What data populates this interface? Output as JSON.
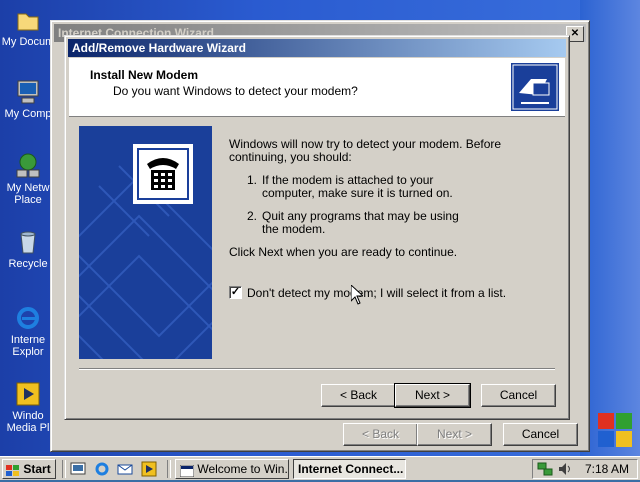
{
  "desktop": {
    "icons": [
      {
        "label": "My Docum",
        "icon": "my-documents-icon"
      },
      {
        "label": "My Comp",
        "icon": "my-computer-icon"
      },
      {
        "label": "My Netw",
        "label2": "Place",
        "icon": "network-places-icon"
      },
      {
        "label": "Recycle",
        "icon": "recycle-bin-icon"
      },
      {
        "label": "Interne",
        "label2": "Explor",
        "icon": "internet-explorer-icon"
      },
      {
        "label": "Windo",
        "label2": "Media Pl",
        "icon": "media-player-icon"
      }
    ]
  },
  "back_window": {
    "title": "Internet Connection Wizard",
    "buttons": {
      "back": "< Back",
      "next": "Next >",
      "cancel": "Cancel"
    }
  },
  "wizard": {
    "title": "Add/Remove Hardware Wizard",
    "header_title": "Install New Modem",
    "header_subtitle": "Do you want Windows to detect your modem?",
    "intro": [
      "Windows will now try to detect your modem.  Before",
      "continuing, you should:"
    ],
    "steps": [
      {
        "num": "1.",
        "lines": [
          "If the modem is attached to your",
          "computer, make sure it is turned on."
        ]
      },
      {
        "num": "2.",
        "lines": [
          "Quit any programs that may be using",
          "the modem."
        ]
      }
    ],
    "click_next": "Click Next when you are ready to continue.",
    "checkbox_label": "Don't detect my modem; I will select it from a list.",
    "checkbox_checked": true,
    "checkmark": "✓",
    "buttons": {
      "back": "< Back",
      "next": "Next >",
      "cancel": "Cancel"
    }
  },
  "taskbar": {
    "start": "Start",
    "tasks": [
      {
        "label": "Welcome to Win...",
        "active": false
      },
      {
        "label": "Internet Connect...",
        "active": true
      }
    ],
    "clock": "7:18 AM"
  },
  "colors": {
    "title_active": "#0a246a",
    "desktop": "#2a5bd0",
    "face": "#d4d0c8"
  }
}
